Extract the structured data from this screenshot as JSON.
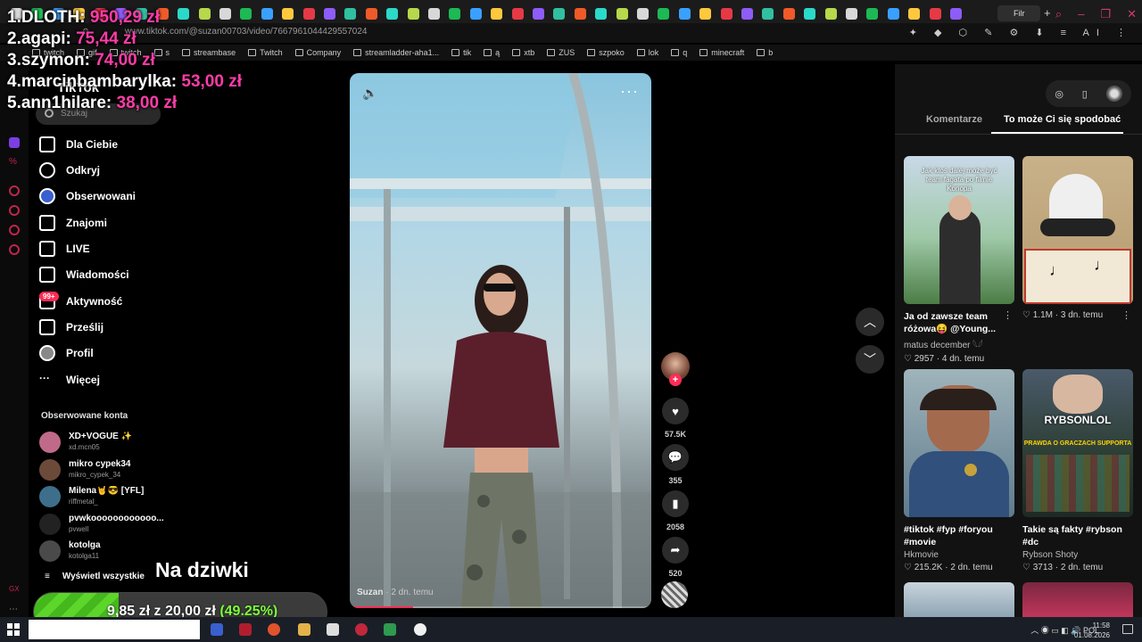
{
  "browser": {
    "url": "www.tiktok.com/@suzan00703/video/7667961044429557024",
    "active_tab_label": "Filr",
    "bookmarks": [
      "twitch",
      "gif",
      "twitch",
      "s",
      "streambase",
      "Twitch",
      "Company",
      "streamladder-aha1...",
      "tik",
      "ą",
      "xtb",
      "ZUS",
      "szpoko",
      "lok",
      "q",
      "minecraft",
      "b"
    ],
    "ext_label": "AI"
  },
  "overlay": {
    "ranking": [
      {
        "label": "1.DLOTH:",
        "amount": "950,29 zł"
      },
      {
        "label": "2.agapi:",
        "amount": "75,44 zł"
      },
      {
        "label": "3.szymon:",
        "amount": "74,00 zł"
      },
      {
        "label": "4.marcinbambarylka:",
        "amount": "53,00 zł"
      },
      {
        "label": "5.ann1hilare:",
        "amount": "38,00 zł"
      }
    ],
    "caption": "Na dziwki",
    "goal": {
      "current": "9,85 zł",
      "sep": "z",
      "target": "20,00 zł",
      "percent_text": "(49.25%)",
      "fraction": 0.4925
    }
  },
  "tiktok": {
    "logo": "TikTok",
    "search_placeholder": "Szukaj",
    "nav": [
      {
        "label": "Dla Ciebie",
        "icon": "home-icon"
      },
      {
        "label": "Odkryj",
        "icon": "compass-icon"
      },
      {
        "label": "Obserwowani",
        "icon": "following-icon"
      },
      {
        "label": "Znajomi",
        "icon": "friends-icon"
      },
      {
        "label": "LIVE",
        "icon": "live-icon"
      },
      {
        "label": "Wiadomości",
        "icon": "messages-icon"
      },
      {
        "label": "Aktywność",
        "icon": "activity-icon"
      },
      {
        "label": "Prześlij",
        "icon": "upload-icon"
      },
      {
        "label": "Profil",
        "icon": "profile-icon"
      },
      {
        "label": "Więcej",
        "icon": "more-icon"
      }
    ],
    "activity_badge": "99+",
    "followed_title": "Obserwowane konta",
    "followed": [
      {
        "name": "XD+VOGUE ✨",
        "handle": "xd.mcn05"
      },
      {
        "name": "mikro cypek34",
        "handle": "mikro_cypek_34"
      },
      {
        "name": "Milena🤘😎 [YFL]",
        "handle": "riffmetal_"
      },
      {
        "name": "pvwkoooooooooooo...",
        "handle": "pvwell"
      },
      {
        "name": "kotolga",
        "handle": "kotolga11"
      }
    ],
    "see_all": "Wyświetl wszystkie"
  },
  "video": {
    "author": "Suzan",
    "posted": " · 2 dn. temu",
    "likes": "57.5K",
    "comments": "355",
    "saves": "2058",
    "shares": "520",
    "progress": 0.21
  },
  "right_panel": {
    "tabs": [
      "Komentarze",
      "To może Ci się spodobać"
    ],
    "cards": [
      {
        "title": "Ja od zawsze team różowa😝 @Young...",
        "author": "matus december 𓆩𓆪",
        "likes": "2957",
        "ago": "4 dn. temu",
        "thumb_caption": "Jak ktoś dalej może być team fagata po filmie Konopa"
      },
      {
        "title": "",
        "author": "",
        "likes": "1.1M",
        "ago": "3 dn. temu",
        "thumb_caption": ""
      },
      {
        "title": "#tiktok #fyp #foryou #movie",
        "author": "Hkmovie",
        "likes": "215.2K",
        "ago": "2 dn. temu",
        "thumb_caption": ""
      },
      {
        "title": "Takie są fakty #rybson #dc",
        "author": "Rybson Shoty",
        "likes": "3713",
        "ago": "2 dn. temu",
        "thumb_caption": "RYBSONLOL",
        "thumb_sub": "PRAWDA O GRACZACH SUPPORTA"
      }
    ]
  },
  "taskbar": {
    "lang": "POL",
    "time": "11:58",
    "date": "01.08.2026"
  },
  "colors": {
    "accent": "#fe2c55",
    "ranking_amount": "#ff3ca8",
    "goal_fill": "#5cd62a",
    "goal_pct": "#7dff3a"
  }
}
